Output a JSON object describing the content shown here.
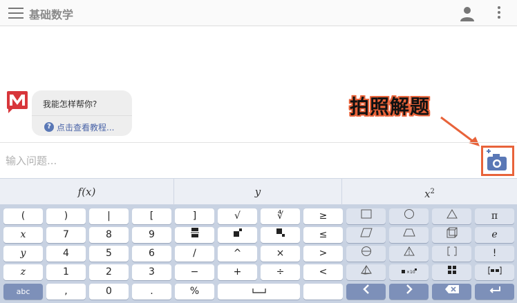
{
  "header": {
    "title": "基础数学",
    "menu_icon": "hamburger-menu-icon",
    "user_icon": "account-icon",
    "more_icon": "more-vert-icon"
  },
  "chat": {
    "avatar_icon": "mathway-logo-icon",
    "message": "我能怎样帮你?",
    "help_link": "点击查看教程..."
  },
  "callout": {
    "text": "拍照解题",
    "color": "#e8633a"
  },
  "input": {
    "placeholder": "输入问题...",
    "camera_icon": "camera-add-icon"
  },
  "keyboard": {
    "tabs": [
      "f(x)",
      "y",
      "x²"
    ],
    "rows": [
      [
        "(",
        ")",
        "|",
        "[",
        "]",
        "√",
        "∜",
        "≥"
      ],
      [
        "x",
        "7",
        "8",
        "9",
        "fraction",
        "exponent",
        "subscript",
        "≤"
      ],
      [
        "y",
        "4",
        "5",
        "6",
        "/",
        "^",
        "×",
        ">"
      ],
      [
        "z",
        "1",
        "2",
        "3",
        "−",
        "+",
        "÷",
        "<"
      ],
      [
        "abc",
        ",",
        "0",
        ".",
        "%",
        "space",
        "",
        ""
      ]
    ],
    "shape_rows": [
      [
        "square-icon",
        "circle-icon",
        "triangle-icon",
        "π"
      ],
      [
        "parallelogram-icon",
        "trapezoid-icon",
        "cube-icon",
        "e"
      ],
      [
        "circle-chord-icon",
        "cone-triangle-icon",
        "bracket-box-icon",
        "!"
      ],
      [
        "pyramid-icon",
        "x10-icon",
        "matrix-icon",
        "mixed-number-icon"
      ],
      [
        "left-arrow-icon",
        "right-arrow-icon",
        "backspace-icon",
        "enter-icon"
      ]
    ],
    "accent": "#7d90b9"
  }
}
